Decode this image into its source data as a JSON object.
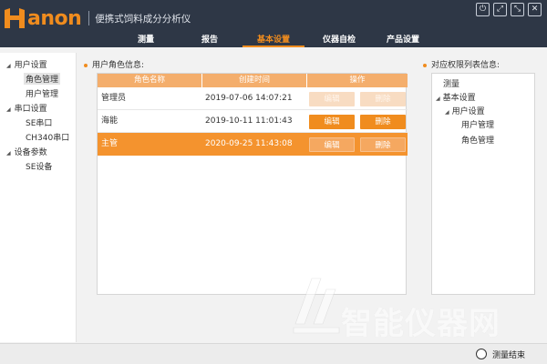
{
  "app": {
    "brand": "anon",
    "title": "便携式饲料成分分析仪"
  },
  "window_controls": [
    {
      "name": "power",
      "glyph": "⏻"
    },
    {
      "name": "restore",
      "glyph": "⤢"
    },
    {
      "name": "fullscreen",
      "glyph": "⤡"
    },
    {
      "name": "close",
      "glyph": "✕"
    }
  ],
  "tabs": [
    {
      "label": "测量",
      "active": false
    },
    {
      "label": "报告",
      "active": false
    },
    {
      "label": "基本设置",
      "active": true
    },
    {
      "label": "仪器自检",
      "active": false
    },
    {
      "label": "产品设置",
      "active": false
    }
  ],
  "sidebar": {
    "groups": [
      {
        "label": "用户设置",
        "items": [
          {
            "label": "角色管理",
            "selected": true
          },
          {
            "label": "用户管理",
            "selected": false
          }
        ]
      },
      {
        "label": "串口设置",
        "items": [
          {
            "label": "SE串口",
            "selected": false
          },
          {
            "label": "CH340串口",
            "selected": false
          }
        ]
      },
      {
        "label": "设备参数",
        "items": [
          {
            "label": "SE设备",
            "selected": false
          }
        ]
      }
    ]
  },
  "roles": {
    "section_label": "用户角色信息:",
    "columns": [
      "角色名称",
      "创建时间",
      "操作"
    ],
    "edit_label": "编辑",
    "delete_label": "删除",
    "rows": [
      {
        "name": "管理员",
        "created": "2019-07-06 14:07:21",
        "actions_enabled": false,
        "selected": false
      },
      {
        "name": "海能",
        "created": "2019-10-11 11:01:43",
        "actions_enabled": true,
        "selected": false
      },
      {
        "name": "主管",
        "created": "2020-09-25 11:43:08",
        "actions_enabled": true,
        "selected": true
      }
    ]
  },
  "permissions": {
    "section_label": "对应权限列表信息:",
    "items": [
      {
        "label": "测量",
        "depth": 0,
        "expanded": null
      },
      {
        "label": "基本设置",
        "depth": 0,
        "expanded": true
      },
      {
        "label": "用户设置",
        "depth": 1,
        "expanded": true
      },
      {
        "label": "用户管理",
        "depth": 2,
        "expanded": null
      },
      {
        "label": "角色管理",
        "depth": 2,
        "expanded": null
      }
    ]
  },
  "watermark": "智能仪器网",
  "status": {
    "label": "测量结束"
  },
  "colors": {
    "accent": "#f08c1e",
    "header_bg": "#2e3746",
    "table_header": "#f4ae6c",
    "selected_row": "#f4932e"
  }
}
